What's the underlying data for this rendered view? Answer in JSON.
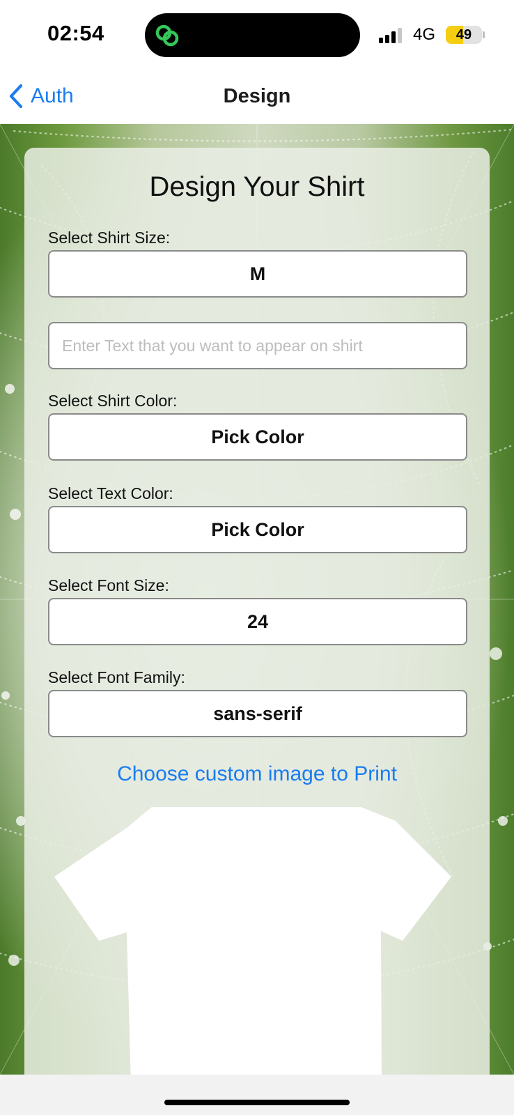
{
  "status_bar": {
    "time": "02:54",
    "network": "4G",
    "battery": "49",
    "battery_level": 0.49,
    "island_icon": "link-rings-icon",
    "colors": {
      "island_icon": "#34c759",
      "battery": "#f5ce12"
    }
  },
  "nav": {
    "back_label": "Auth",
    "title": "Design",
    "accent": "#1a7cf0"
  },
  "form": {
    "heading": "Design Your Shirt",
    "size_label": "Select Shirt Size:",
    "size_value": "M",
    "text_placeholder": "Enter Text that you want to appear on shirt",
    "text_value": "",
    "shirt_color_label": "Select Shirt Color:",
    "shirt_color_button": "Pick Color",
    "text_color_label": "Select Text Color:",
    "text_color_button": "Pick Color",
    "font_size_label": "Select Font Size:",
    "font_size_value": "24",
    "font_family_label": "Select Font Family:",
    "font_family_value": "sans-serif",
    "image_link": "Choose custom image to Print"
  },
  "preview": {
    "shirt_color": "#ffffff"
  }
}
